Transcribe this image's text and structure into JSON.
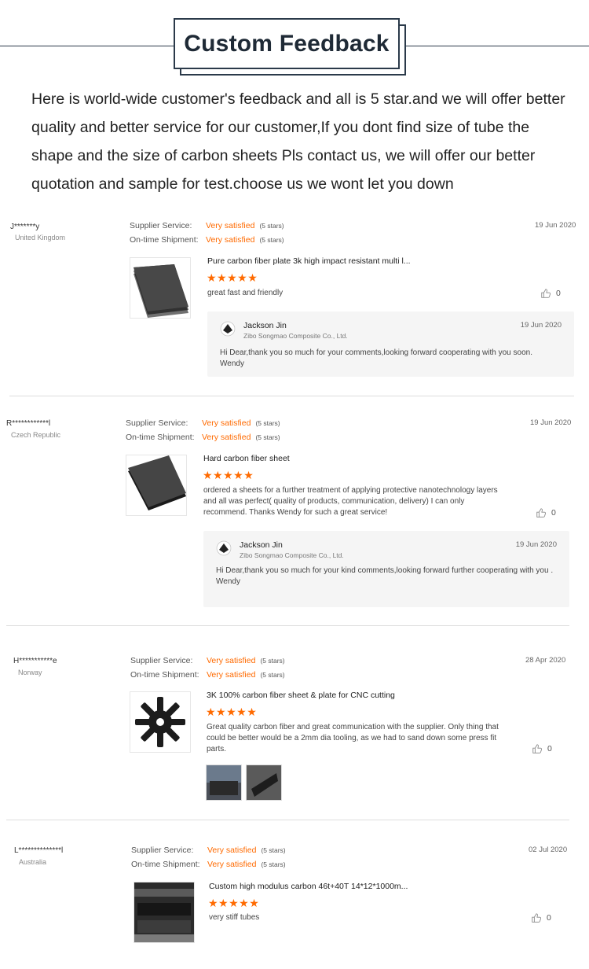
{
  "header": {
    "title": "Custom Feedback",
    "intro": "Here is world-wide customer's feedback and all is 5 star.and we will offer better quality and better service for our customer,If you dont find size of tube the shape and the size of carbon sheets Pls contact us, we will offer our better quotation and sample for test.choose us we wont let you down"
  },
  "labels": {
    "supplier_service": "Supplier Service:",
    "on_time_shipment": "On-time Shipment:",
    "very_satisfied": "Very satisfied",
    "five_stars": "(5 stars)",
    "star_glyphs": "★★★★★"
  },
  "colors": {
    "accent": "#ff6a00",
    "header_border": "#2b3a4a",
    "reply_bg": "#f5f5f5"
  },
  "reviews": [
    {
      "name": "J*******y",
      "country": "United Kingdom",
      "date": "19 Jun 2020",
      "product": "Pure carbon fiber plate 3k high impact resistant multi l...",
      "rating": 5,
      "comment": "great fast and friendly",
      "likes": "0",
      "reply": {
        "name": "Jackson Jin",
        "company": "Zibo Songmao Composite Co., Ltd.",
        "date": "19 Jun 2020",
        "text": "Hi Dear,thank you so much for your comments,looking forward cooperating with you soon.",
        "sign": "Wendy"
      }
    },
    {
      "name": "R************l",
      "country": "Czech Republic",
      "date": "19 Jun 2020",
      "product": "Hard carbon fiber sheet",
      "rating": 5,
      "comment": "ordered a sheets for a further treatment of applying protective nanotechnology layers and all was perfect( quality of products, communication, delivery) I can only recommend. Thanks Wendy for such a great service!",
      "likes": "0",
      "reply": {
        "name": "Jackson Jin",
        "company": "Zibo Songmao Composite Co., Ltd.",
        "date": "19 Jun 2020",
        "text": "Hi Dear,thank you so much for your kind comments,looking forward further cooperating with you .",
        "sign": "Wendy"
      }
    },
    {
      "name": "H***********e",
      "country": "Norway",
      "date": "28 Apr 2020",
      "product": "3K 100% carbon fiber sheet & plate for CNC cutting",
      "rating": 5,
      "comment": "Great quality carbon fiber and great communication with the supplier. Only thing that could be better would be a 2mm dia tooling, as we had to sand down some press fit parts.",
      "likes": "0"
    },
    {
      "name": "L**************l",
      "country": "Australia",
      "date": "02 Jul 2020",
      "product": "Custom high modulus carbon 46t+40T 14*12*1000m...",
      "rating": 5,
      "comment": "very stiff tubes",
      "likes": "0"
    }
  ]
}
